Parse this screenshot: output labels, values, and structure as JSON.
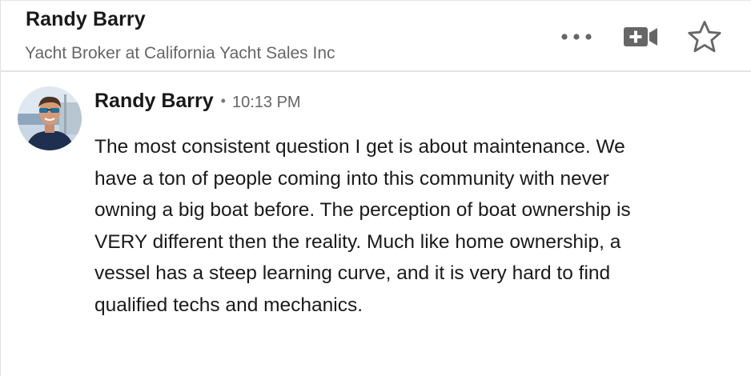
{
  "header": {
    "name": "Randy Barry",
    "subtitle": "Yacht Broker at California Yacht Sales Inc",
    "actions": [
      {
        "icon": "more-options-icon"
      },
      {
        "icon": "video-call-icon"
      },
      {
        "icon": "star-icon"
      }
    ]
  },
  "message": {
    "sender": "Randy Barry",
    "separator": "•",
    "time": "10:13 PM",
    "body": "The most consistent question I get is about maintenance. We have a ton of people coming into this community with never owning a big boat before. The perception of boat ownership is VERY different then the reality. Much like home ownership, a vessel has a steep learning curve, and it is very hard to find qualified techs and mechanics."
  },
  "colors": {
    "icon_gray": "#666666",
    "text_primary": "#191919",
    "text_secondary": "#666666",
    "divider": "#e4e4e4"
  }
}
